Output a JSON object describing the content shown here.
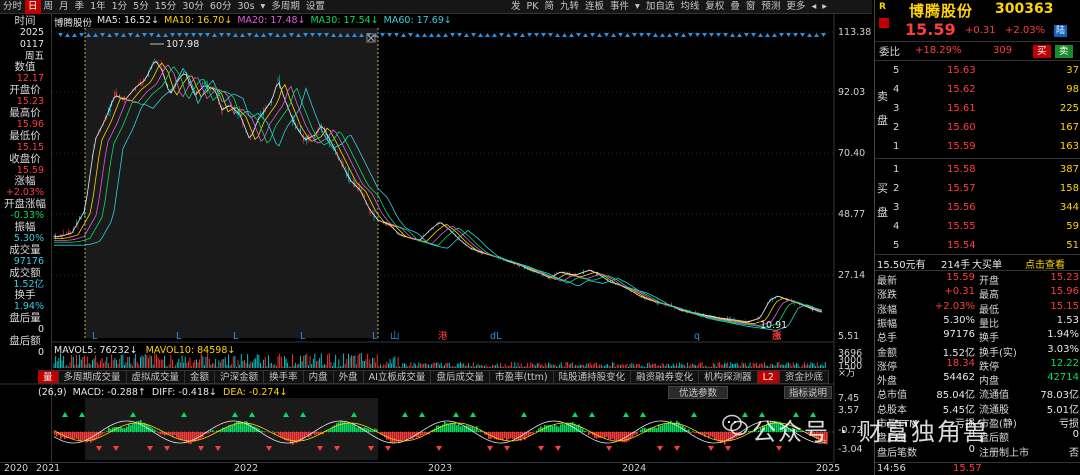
{
  "toolbar": {
    "periods": [
      "分时",
      "日",
      "周",
      "月",
      "季",
      "1年",
      "1分",
      "5分",
      "15分",
      "30分",
      "60分",
      "30s",
      "▾",
      "多周期",
      "设置"
    ],
    "active_period": "日",
    "tools": [
      "发",
      "PK",
      "简",
      "九转",
      "连板",
      "事件",
      "▾",
      "加自选",
      "均线",
      "复权",
      "叠",
      "窗",
      "预测",
      "更多",
      "◂",
      "▸"
    ]
  },
  "info_panel": {
    "items": [
      {
        "label": "时间",
        "value": "2025",
        "color": "white"
      },
      {
        "label": "",
        "value": "0117",
        "color": "white"
      },
      {
        "label": "",
        "value": "周五",
        "color": "white"
      },
      {
        "label": "数值",
        "value": "12.17",
        "color": "red"
      },
      {
        "label": "开盘价",
        "value": "15.23",
        "color": "red"
      },
      {
        "label": "最高价",
        "value": "15.96",
        "color": "red"
      },
      {
        "label": "最低价",
        "value": "15.15",
        "color": "red"
      },
      {
        "label": "收盘价",
        "value": "15.59",
        "color": "red"
      },
      {
        "label": "涨幅",
        "value": "+2.03%",
        "color": "red"
      },
      {
        "label": "开盘涨幅",
        "value": "-0.33%",
        "color": "green"
      },
      {
        "label": "振幅",
        "value": "5.30%",
        "color": "cyan"
      },
      {
        "label": "成交量",
        "value": "97176",
        "color": "cyan"
      },
      {
        "label": "成交额",
        "value": "1.52亿",
        "color": "cyan"
      },
      {
        "label": "换手",
        "value": "1.94%",
        "color": "cyan"
      },
      {
        "label": "盘后量",
        "value": "0",
        "color": "white"
      },
      {
        "label": "盘后额",
        "value": "0",
        "color": "white"
      }
    ]
  },
  "chart_legend": {
    "name": "博腾股份",
    "ma5": "MA5: 16.52↓",
    "ma10": "MA10: 16.70↓",
    "ma20": "MA20: 17.48↓",
    "ma30": "MA30: 17.54↓",
    "ma60": "MA60: 17.69↓"
  },
  "price_axis": [
    "113.38",
    "92.03",
    "70.40",
    "48.77",
    "27.14",
    "5.51"
  ],
  "annotations": {
    "high": "107.98",
    "low": "10.91"
  },
  "event_marks": [
    "L",
    "L",
    "L",
    "L",
    "L",
    "山",
    "港",
    "dL",
    "q",
    "涨"
  ],
  "volume_legend": {
    "mavol5": "MAVOL5: 76232↓",
    "mavol10": "MAVOL10: 84598↓"
  },
  "volume_axis": [
    "3696",
    "3000",
    "1500",
    "×万"
  ],
  "indicator_tabs": [
    "量",
    "多周期成交量",
    "虚拟成交量",
    "金额",
    "沪深金额",
    "换手率",
    "内盘",
    "外盘",
    "AI立板成交量",
    "盘后成交量",
    "市盈率(ttm)",
    "陆股通持股变化",
    "融资融券变化",
    "机构探测器",
    "L2",
    "资金抄底"
  ],
  "macd_legend": {
    "params": "(26,9)",
    "macd": "MACD: -0.288↑",
    "diff": "DIFF: -0.418↓",
    "dea": "DEA: -0.274↓"
  },
  "macd_axis": [
    "7.45",
    "3.57",
    "-0.72",
    "-3.04"
  ],
  "macd_buttons": {
    "youxuan": "优选参数",
    "zhibiao": "指标说明"
  },
  "x_axis": [
    "2020",
    "2021",
    "2022",
    "2023",
    "2024",
    "2025"
  ],
  "quote": {
    "badge": "R",
    "name": "博腾股份",
    "code": "300363",
    "price": "15.59",
    "change": "+0.31",
    "pct": "+2.03%",
    "lu": "陆",
    "weibi_label": "委比",
    "weibi": "+18.29%",
    "weicha": "309",
    "buy_btn": "买",
    "sell_btn": "卖",
    "sell_label": "卖盘",
    "buy_label": "买盘",
    "sells": [
      {
        "lvl": "5",
        "price": "15.63",
        "vol": "37"
      },
      {
        "lvl": "4",
        "price": "15.62",
        "vol": "98"
      },
      {
        "lvl": "3",
        "price": "15.61",
        "vol": "225"
      },
      {
        "lvl": "2",
        "price": "15.60",
        "vol": "167"
      },
      {
        "lvl": "1",
        "price": "15.59",
        "vol": "163"
      }
    ],
    "buys": [
      {
        "lvl": "1",
        "price": "15.58",
        "vol": "387"
      },
      {
        "lvl": "2",
        "price": "15.57",
        "vol": "158"
      },
      {
        "lvl": "3",
        "price": "15.56",
        "vol": "344"
      },
      {
        "lvl": "4",
        "price": "15.55",
        "vol": "59"
      },
      {
        "lvl": "5",
        "price": "15.54",
        "vol": "51"
      }
    ],
    "bigbuy": {
      "price": "15.50元有",
      "lots": "214手",
      "label": "大买单",
      "link": "点击查看"
    },
    "stats": [
      [
        "最新",
        "15.59",
        "开盘",
        "15.23"
      ],
      [
        "涨跌",
        "+0.31",
        "最高",
        "15.96"
      ],
      [
        "涨幅",
        "+2.03%",
        "最低",
        "15.15"
      ],
      [
        "振幅",
        "5.30%",
        "量比",
        "1.53"
      ],
      [
        "总手",
        "97176",
        "换手",
        "1.94%"
      ],
      [
        "金额",
        "1.52亿",
        "换手(实)",
        "3.03%"
      ],
      [
        "涨停",
        "18.34",
        "跌停",
        "12.22"
      ],
      [
        "外盘",
        "54462",
        "内盘",
        "42714"
      ],
      [
        "总市值",
        "85.04亿",
        "流通值",
        "78.03亿"
      ],
      [
        "总股本",
        "5.45亿",
        "流通股",
        "5.01亿"
      ],
      [
        "市盈TTM",
        "亏损",
        "市盈(静)",
        "亏损"
      ],
      [
        "盘后量",
        "0",
        "盘后额",
        "0"
      ],
      [
        "盘后笔数",
        "0",
        "注册制上市",
        "否"
      ]
    ],
    "tick_time": "14:56",
    "tick_price": "15.57"
  },
  "watermark": "公众号 · 财富独角兽"
}
